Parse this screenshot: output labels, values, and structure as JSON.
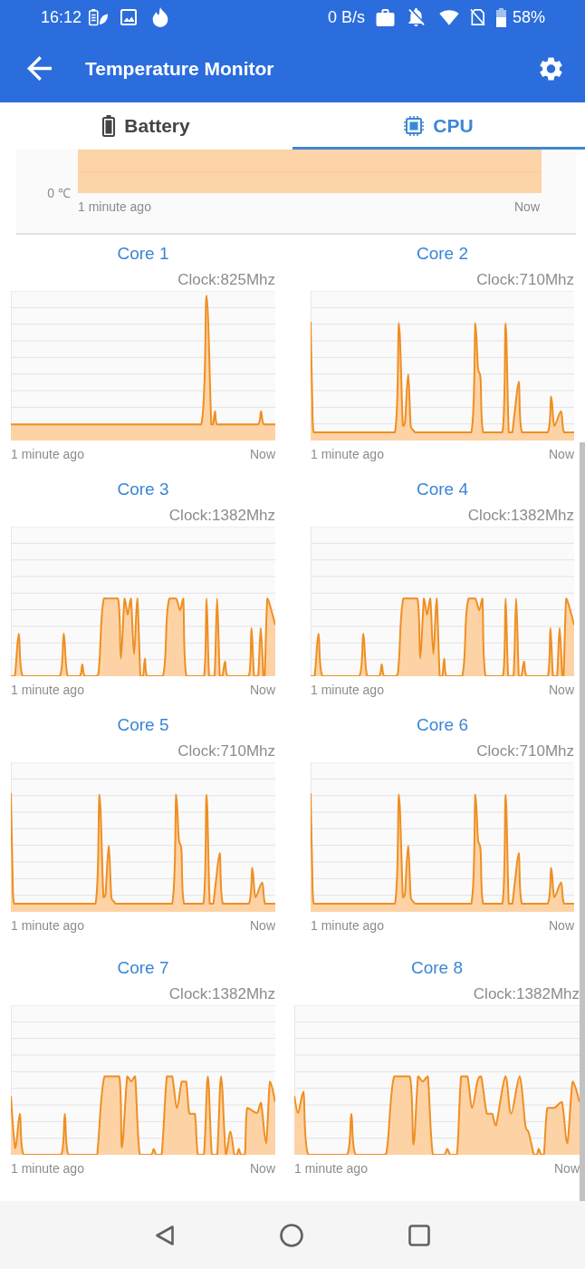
{
  "status_bar": {
    "time": "16:12",
    "net_speed": "0 B/s",
    "battery": "58%"
  },
  "app_bar": {
    "title": "Temperature Monitor"
  },
  "tabs": [
    {
      "label": "Battery",
      "selected": false
    },
    {
      "label": "CPU",
      "selected": true
    }
  ],
  "temperature_chart": {
    "y_tick": "0 ℃",
    "x_start": "1 minute ago",
    "x_end": "Now"
  },
  "cores": [
    {
      "title": "Core 1",
      "clock": "Clock:825Mhz",
      "x_start": "1 minute ago",
      "x_end": "Now"
    },
    {
      "title": "Core 2",
      "clock": "Clock:710Mhz",
      "x_start": "1 minute ago",
      "x_end": "Now"
    },
    {
      "title": "Core 3",
      "clock": "Clock:1382Mhz",
      "x_start": "1 minute ago",
      "x_end": "Now"
    },
    {
      "title": "Core 4",
      "clock": "Clock:1382Mhz",
      "x_start": "1 minute ago",
      "x_end": "Now"
    },
    {
      "title": "Core 5",
      "clock": "Clock:710Mhz",
      "x_start": "1 minute ago",
      "x_end": "Now"
    },
    {
      "title": "Core 6",
      "clock": "Clock:710Mhz",
      "x_start": "1 minute ago",
      "x_end": "Now"
    },
    {
      "title": "Core 7",
      "clock": "Clock:1382Mhz",
      "x_start": "1 minute ago",
      "x_end": "Now"
    },
    {
      "title": "Core 8",
      "clock": "Clock:1382Mhz",
      "x_start": "1 minute ago",
      "x_end": "Now"
    }
  ]
}
